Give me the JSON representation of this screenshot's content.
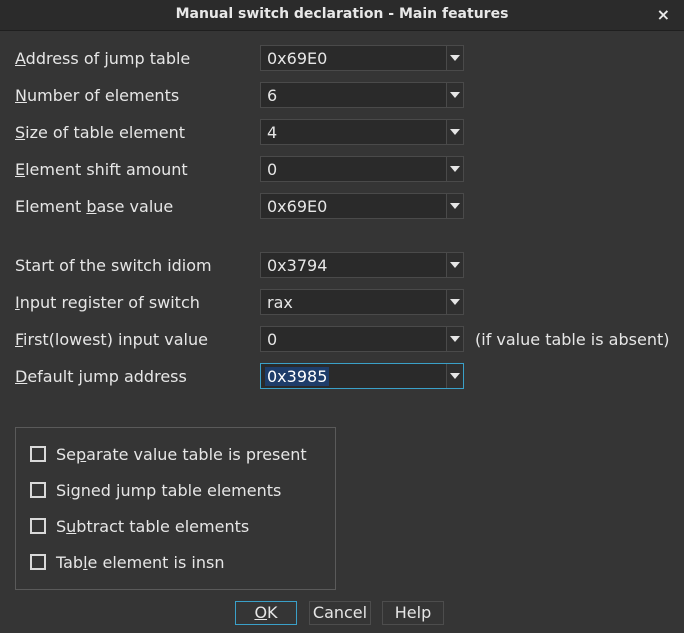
{
  "dialog": {
    "title": "Manual switch declaration - Main features",
    "close_glyph": "×"
  },
  "fields": [
    {
      "label_u": "A",
      "label_rest": "ddress of jump table",
      "value": "0x69E0"
    },
    {
      "label_u": "N",
      "label_rest": "umber of elements",
      "value": "6"
    },
    {
      "label_u": "S",
      "label_rest": "ize of table element",
      "value": "4"
    },
    {
      "label_u": "E",
      "label_rest": "lement shift amount",
      "value": "0"
    },
    {
      "label_pre": "Element ",
      "label_u": "b",
      "label_rest": "ase value",
      "value": "0x69E0"
    },
    {
      "label": "Start of the switch idiom",
      "value": "0x3794"
    },
    {
      "label_u": "I",
      "label_rest": "nput register of switch",
      "value": "rax"
    },
    {
      "label_u": "F",
      "label_rest": "irst(lowest) input value",
      "value": "0"
    },
    {
      "label_u": "D",
      "label_rest": "efault jump address",
      "value": "0x3985"
    }
  ],
  "hint": "(if value table is absent)",
  "options": [
    {
      "pre": "Se",
      "u": "p",
      "rest": "arate value table is present",
      "checked": false
    },
    {
      "pre": "Si",
      "u": "g",
      "rest": "ned jump table elements",
      "checked": false
    },
    {
      "pre": "S",
      "u": "u",
      "rest": "btract table elements",
      "checked": false
    },
    {
      "pre": "Tab",
      "u": "l",
      "rest": "e element is insn",
      "checked": false
    }
  ],
  "buttons": {
    "ok_u": "O",
    "ok_rest": "K",
    "cancel": "Cancel",
    "help": "Help"
  },
  "colors": {
    "background": "#353535",
    "focus_border": "#3aa0c8",
    "selection": "#1e3d6a"
  },
  "icons": {
    "dropdown": "triangle-down",
    "close": "×"
  }
}
